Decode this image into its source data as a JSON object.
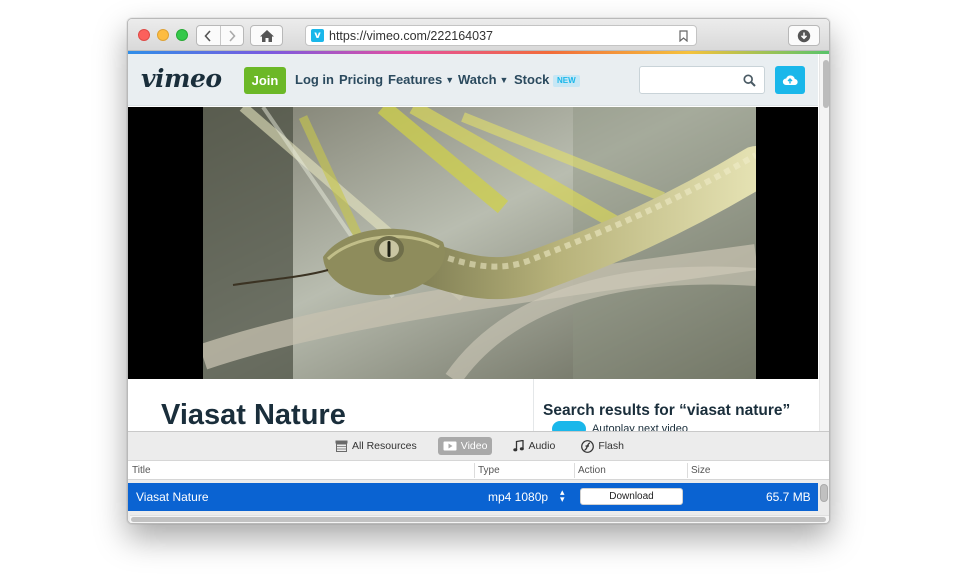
{
  "browser": {
    "url": "https://vimeo.com/222164037",
    "favicon_letter": "v",
    "icons": [
      "back-icon",
      "forward-icon",
      "home-icon",
      "bookmark-icon",
      "download-icon"
    ]
  },
  "site": {
    "logo": "vimeo",
    "join_label": "Join",
    "nav": [
      {
        "label": "Log in"
      },
      {
        "label": "Pricing"
      },
      {
        "label": "Features",
        "dropdown": true
      },
      {
        "label": "Watch",
        "dropdown": true
      },
      {
        "label": "Stock",
        "badge": "NEW"
      }
    ],
    "search_placeholder": "",
    "brand_color": "#1ab7ea",
    "join_color": "#6cb827"
  },
  "video": {
    "title": "Viasat Nature"
  },
  "sidebar": {
    "results_heading": "Search results for “viasat nature”",
    "autoplay_label": "Autoplay next video"
  },
  "extension": {
    "tabs": [
      {
        "label": "All Resources",
        "icon": "archive-icon",
        "active": false
      },
      {
        "label": "Video",
        "icon": "video-icon",
        "active": true
      },
      {
        "label": "Audio",
        "icon": "music-note-icon",
        "active": false
      },
      {
        "label": "Flash",
        "icon": "flash-icon",
        "active": false
      }
    ],
    "columns": [
      "Title",
      "Type",
      "Action",
      "Size"
    ],
    "rows": [
      {
        "title": "Viasat Nature",
        "type": "mp4 1080p",
        "action": "Download",
        "size": "65.7 MB"
      }
    ],
    "selection_color": "#0a63d2"
  }
}
